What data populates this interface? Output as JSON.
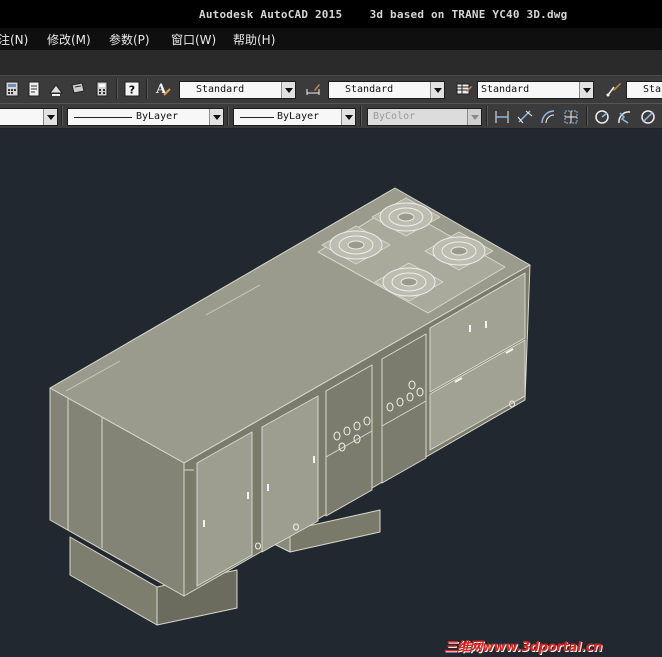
{
  "window": {
    "app_title": "Autodesk AutoCAD 2015",
    "document_title": "3d based on TRANE YC40 3D.dwg"
  },
  "menu": {
    "items": [
      {
        "label": "注(N)"
      },
      {
        "label": "修改(M)"
      },
      {
        "label": "参数(P)"
      },
      {
        "label": "窗口(W)"
      },
      {
        "label": "帮助(H)"
      }
    ]
  },
  "styles_toolbar": {
    "text_style": "Standard",
    "dimension_style": "Standard",
    "table_style": "Standard",
    "multileader_style": "Sta"
  },
  "properties_toolbar": {
    "layer": "",
    "color": "",
    "linetype": "ByLayer",
    "lineweight": "ByLayer",
    "plot_style": "ByColor"
  },
  "watermark": {
    "text": "三维网www.3dportal.cn"
  },
  "colors": {
    "viewport_bg": "#212830",
    "model_top": "#9a9a8c",
    "model_side": "#8a8a7b",
    "model_front": "#777768",
    "watermark": "#e0231c"
  }
}
